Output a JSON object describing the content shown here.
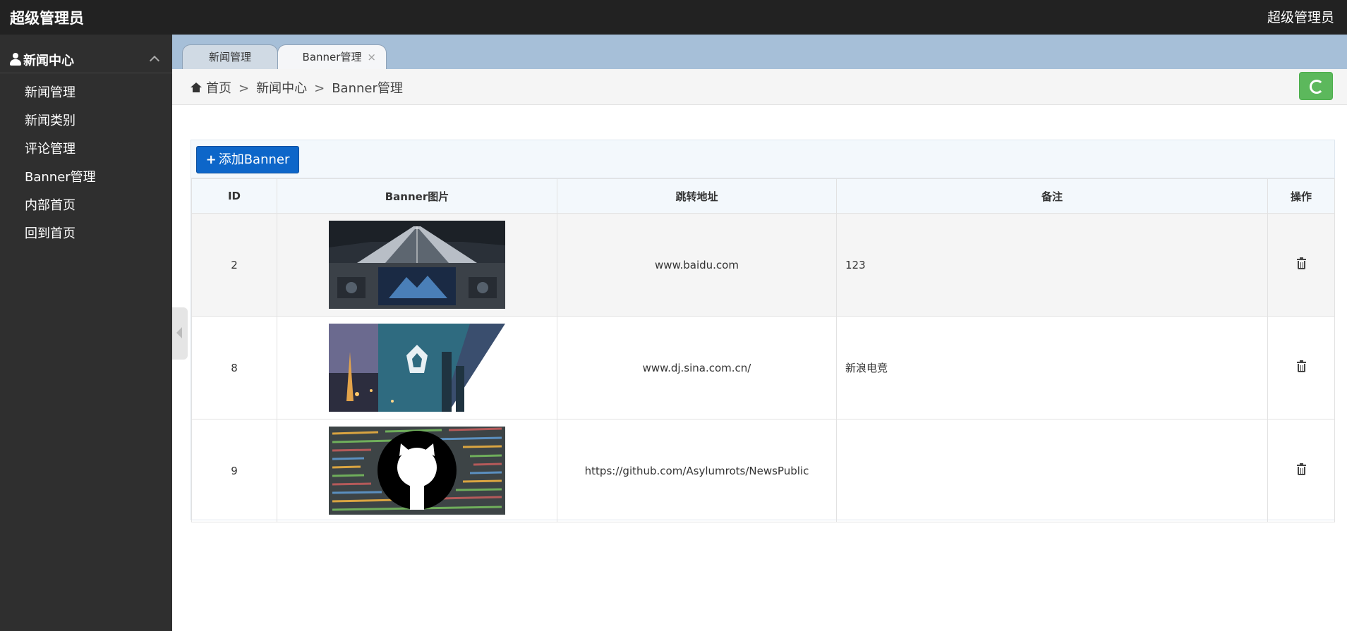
{
  "header": {
    "brand": "超级管理员",
    "user": "超级管理员"
  },
  "sidebar": {
    "group_title": "新闻中心",
    "items": [
      {
        "label": "新闻管理"
      },
      {
        "label": "新闻类别"
      },
      {
        "label": "评论管理"
      },
      {
        "label": "Banner管理"
      },
      {
        "label": "内部首页"
      },
      {
        "label": "回到首页"
      }
    ]
  },
  "tabs": [
    {
      "label": "新闻管理"
    },
    {
      "label": "Banner管理",
      "close": "×"
    }
  ],
  "breadcrumb": {
    "home": "首页",
    "sep": ">",
    "section": "新闻中心",
    "page": "Banner管理"
  },
  "toolbar": {
    "add_label": "添加Banner"
  },
  "table": {
    "headers": [
      "ID",
      "Banner图片",
      "跳转地址",
      "备注",
      "操作"
    ],
    "rows": [
      {
        "id": "2",
        "url": "www.baidu.com",
        "note": "123",
        "image": "cockpit-banner"
      },
      {
        "id": "8",
        "url": "www.dj.sina.com.cn/",
        "note": "新浪电竞",
        "image": "esports-city-banner"
      },
      {
        "id": "9",
        "url": "https://github.com/Asylumrots/NewsPublic",
        "note": "",
        "image": "github-banner"
      }
    ]
  },
  "colors": {
    "topbar": "#222222",
    "sidebar": "#2f2f2f",
    "tabbar": "#a6bfd8",
    "primary": "#0d66c9",
    "success": "#5cb85c"
  }
}
